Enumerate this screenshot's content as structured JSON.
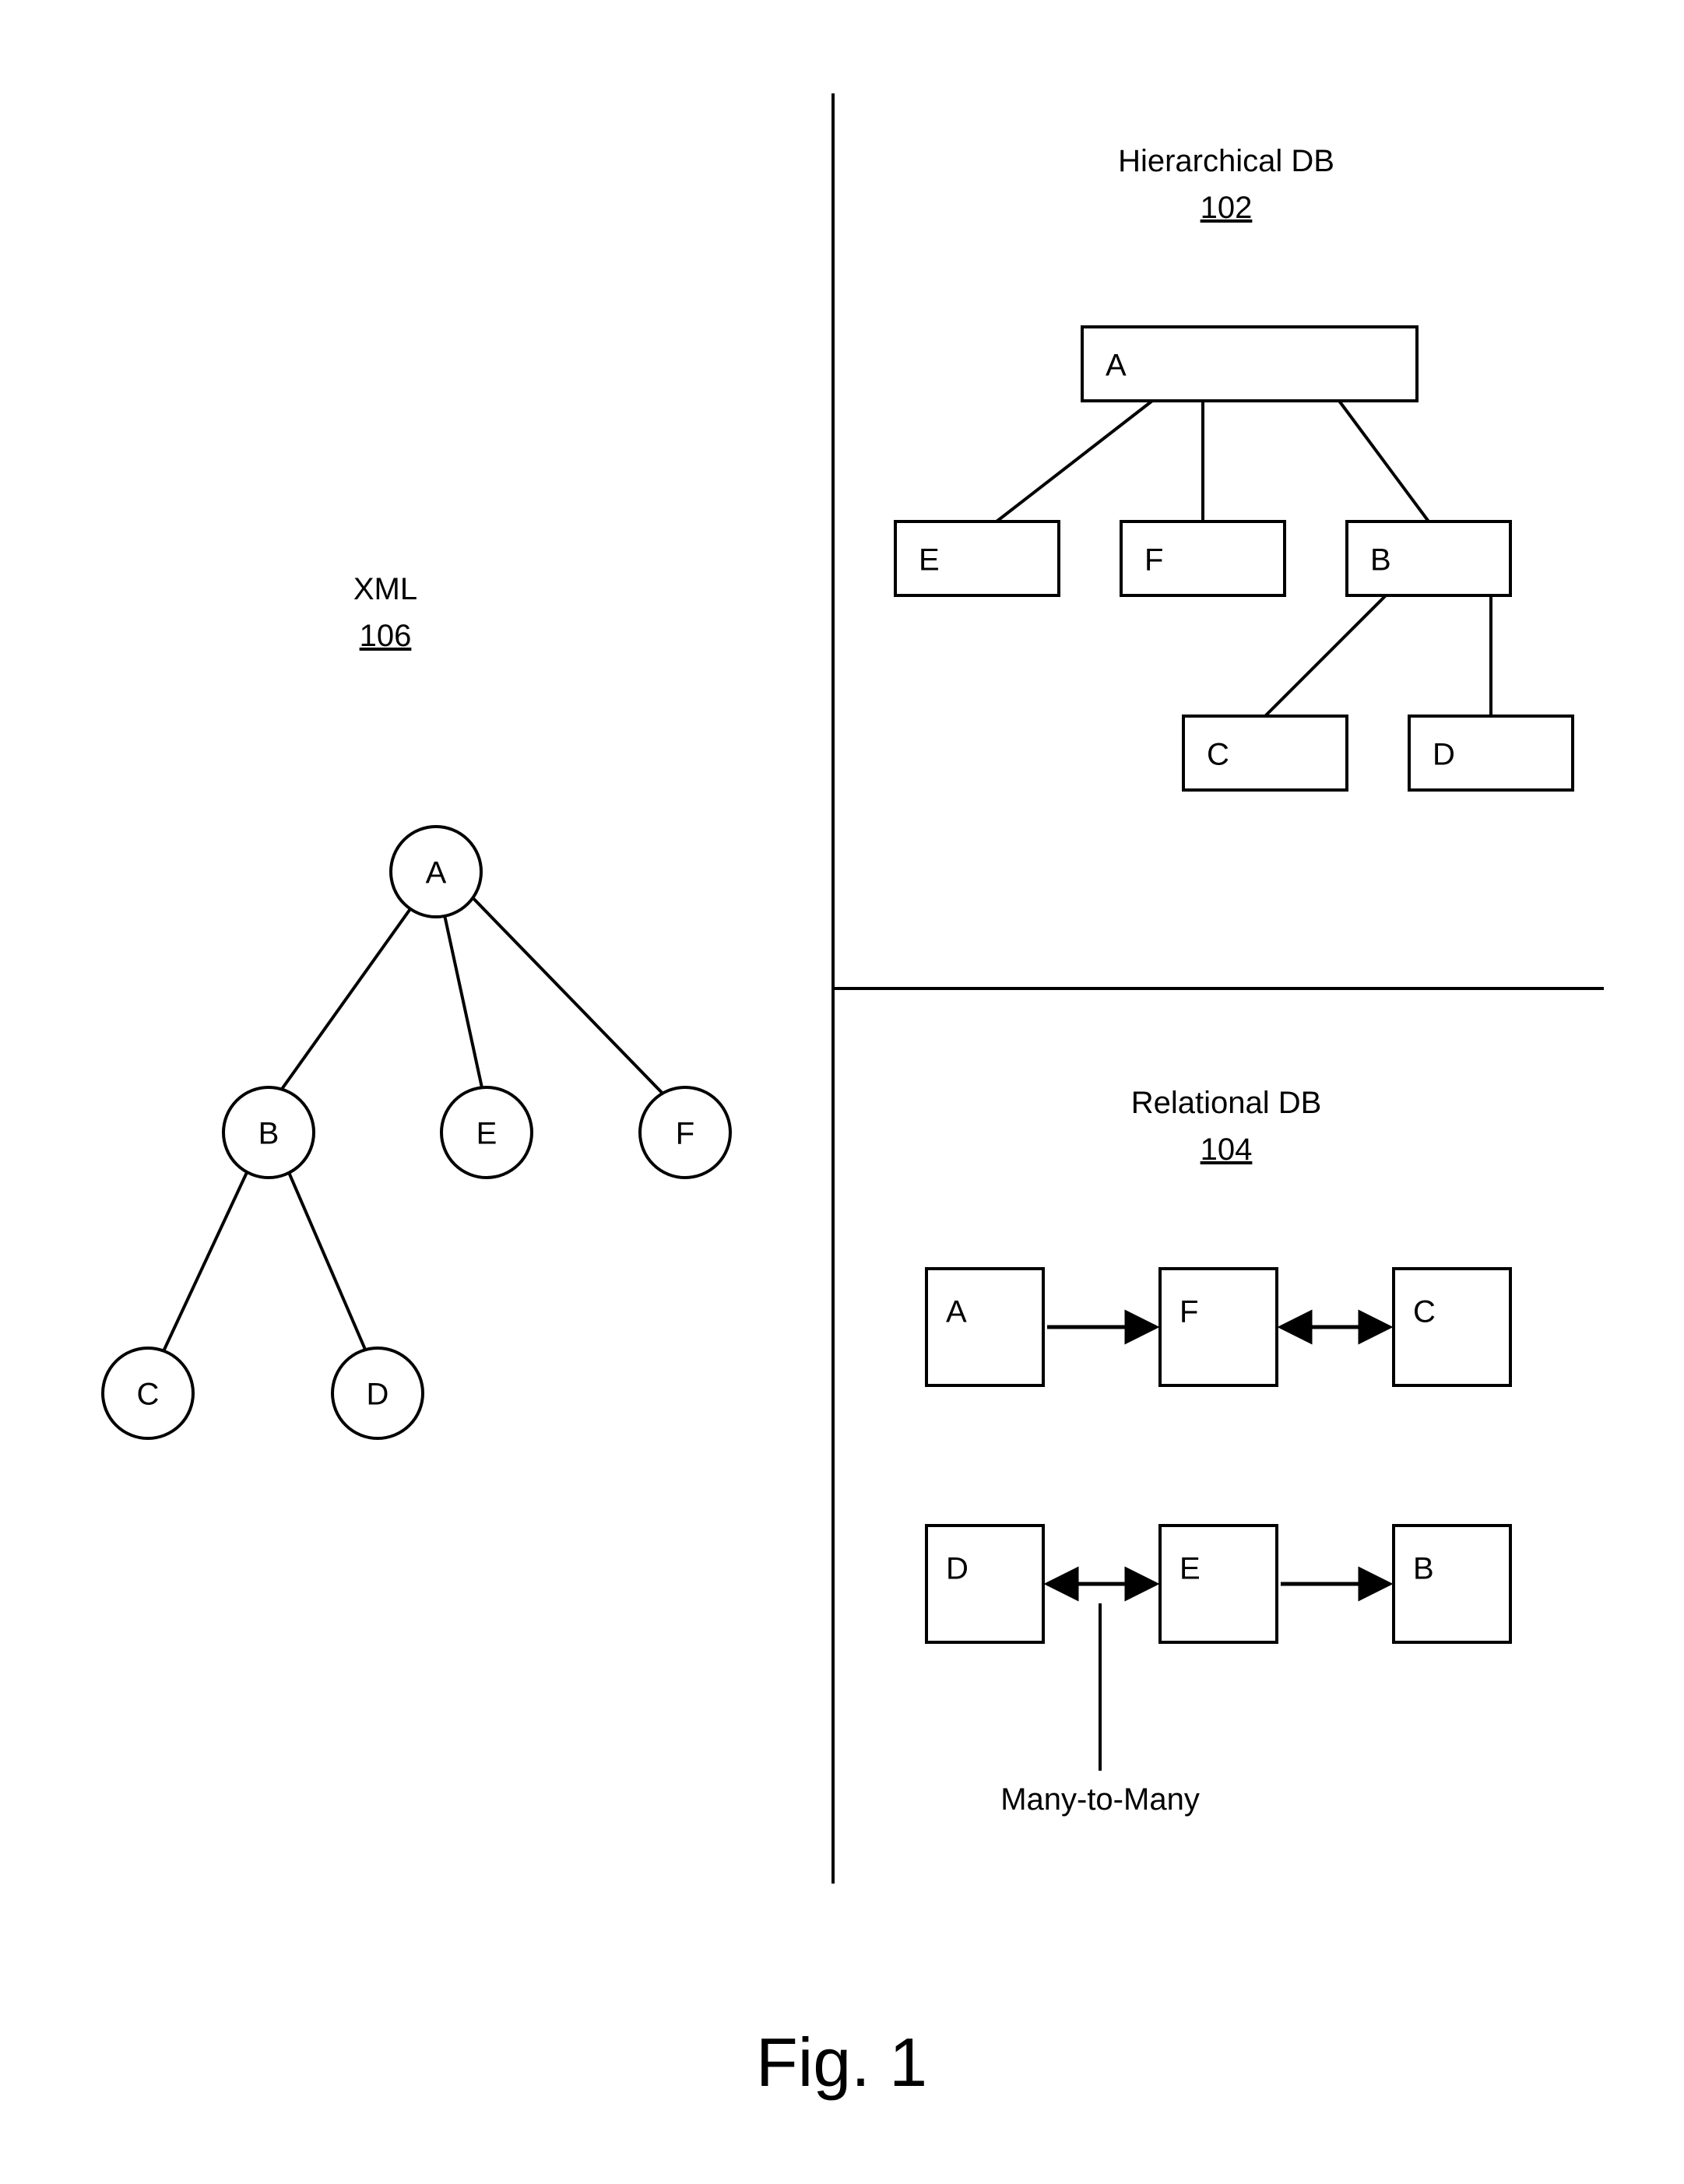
{
  "figure_label": "Fig. 1",
  "xml": {
    "title": "XML",
    "ref": "106",
    "nodes": {
      "A": "A",
      "B": "B",
      "C": "C",
      "D": "D",
      "E": "E",
      "F": "F"
    }
  },
  "hier": {
    "title": "Hierarchical DB",
    "ref": "102",
    "nodes": {
      "A": "A",
      "B": "B",
      "C": "C",
      "D": "D",
      "E": "E",
      "F": "F"
    }
  },
  "rel": {
    "title": "Relational DB",
    "ref": "104",
    "note": "Many-to-Many",
    "nodes": {
      "A": "A",
      "B": "B",
      "C": "C",
      "D": "D",
      "E": "E",
      "F": "F"
    }
  }
}
